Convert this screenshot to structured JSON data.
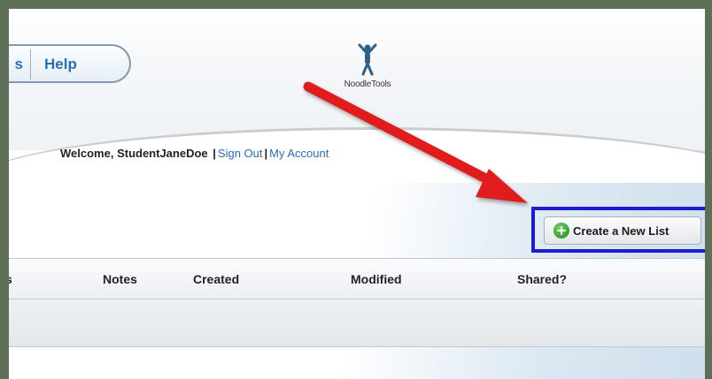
{
  "nav": {
    "prev_tab_partial": "s",
    "help_label": "Help"
  },
  "logo": {
    "text": "NoodleTools",
    "icon": "person-jumping-icon"
  },
  "welcome": {
    "prefix": "Welcome, ",
    "username": "StudentJaneDoe",
    "sign_out": "Sign Out",
    "my_account": "My Account",
    "separator": "|"
  },
  "toolbar": {
    "create_label": "Create a New List",
    "create_icon": "plus-circle-icon"
  },
  "table": {
    "columns": [
      "s",
      "Notes",
      "Created",
      "Modified",
      "Shared?"
    ]
  },
  "colors": {
    "link": "#2a6fb5",
    "arrow": "#e01b1b",
    "highlight": "#1c1dcc",
    "add_green": "#3aa53a"
  }
}
